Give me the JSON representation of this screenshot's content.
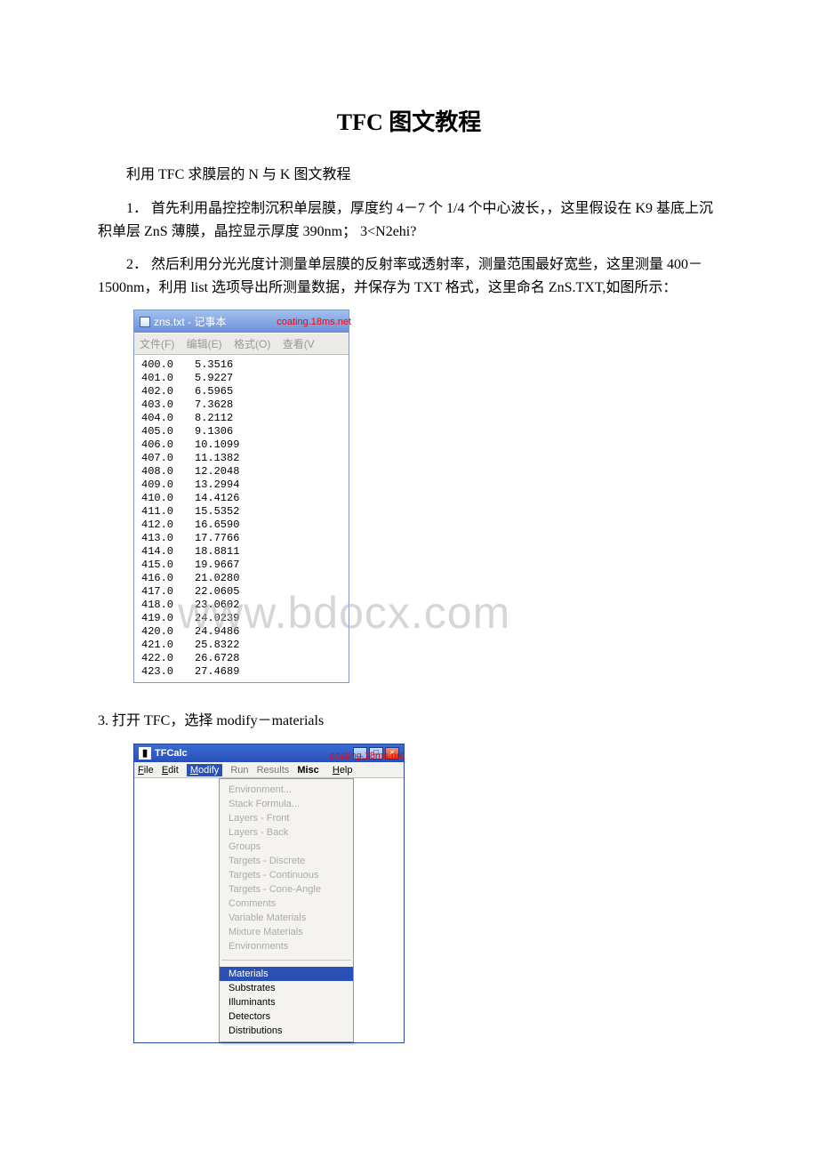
{
  "title": "TFC 图文教程",
  "paragraphs": {
    "p1": "利用 TFC 求膜层的 N 与 K 图文教程",
    "p2": "1．  首先利用晶控控制沉积单层膜，厚度约 4－7 个 1/4 个中心波长，，这里假设在 K9 基底上沉积单层 ZnS 薄膜，晶控显示厚度 390nm； 3<N2ehi?",
    "p3": "2．  然后利用分光光度计测量单层膜的反射率或透射率，测量范围最好宽些，这里测量 400－1500nm，利用 list 选项导出所测量数据，并保存为 TXT 格式，这里命名 ZnS.TXT,如图所示：",
    "p4": "3. 打开 TFC，选择 modify－materials"
  },
  "watermarks": {
    "site": "coating.18ms.net",
    "big": "www.bdocx.com"
  },
  "notepad": {
    "title": "zns.txt - 记事本",
    "menu": {
      "file": "文件(F)",
      "edit": "编辑(E)",
      "format": "格式(O)",
      "view": "查看(V"
    },
    "rows": [
      {
        "wl": "400.0",
        "val": "5.3516"
      },
      {
        "wl": "401.0",
        "val": "5.9227"
      },
      {
        "wl": "402.0",
        "val": "6.5965"
      },
      {
        "wl": "403.0",
        "val": "7.3628"
      },
      {
        "wl": "404.0",
        "val": "8.2112"
      },
      {
        "wl": "405.0",
        "val": "9.1306"
      },
      {
        "wl": "406.0",
        "val": "10.1099"
      },
      {
        "wl": "407.0",
        "val": "11.1382"
      },
      {
        "wl": "408.0",
        "val": "12.2048"
      },
      {
        "wl": "409.0",
        "val": "13.2994"
      },
      {
        "wl": "410.0",
        "val": "14.4126"
      },
      {
        "wl": "411.0",
        "val": "15.5352"
      },
      {
        "wl": "412.0",
        "val": "16.6590"
      },
      {
        "wl": "413.0",
        "val": "17.7766"
      },
      {
        "wl": "414.0",
        "val": "18.8811"
      },
      {
        "wl": "415.0",
        "val": "19.9667"
      },
      {
        "wl": "416.0",
        "val": "21.0280"
      },
      {
        "wl": "417.0",
        "val": "22.0605"
      },
      {
        "wl": "418.0",
        "val": "23.0602"
      },
      {
        "wl": "419.0",
        "val": "24.0239"
      },
      {
        "wl": "420.0",
        "val": "24.9486"
      },
      {
        "wl": "421.0",
        "val": "25.8322"
      },
      {
        "wl": "422.0",
        "val": "26.6728"
      },
      {
        "wl": "423.0",
        "val": "27.4689"
      }
    ]
  },
  "tfcalc": {
    "title": "TFCalc",
    "menubar": {
      "file": "File",
      "edit": "Edit",
      "modify": "Modify",
      "run": "Run",
      "results": "Results",
      "misc": "Misc",
      "help": "Help"
    },
    "dropdown": {
      "top": [
        "Environment...",
        "Stack Formula...",
        "Layers - Front",
        "Layers - Back",
        "Groups",
        "Targets - Discrete",
        "Targets - Continuous",
        "Targets - Cone-Angle",
        "Comments",
        "Variable Materials",
        "Mixture Materials",
        "Environments"
      ],
      "bottom": [
        "Materials",
        "Substrates",
        "Illuminants",
        "Detectors",
        "Distributions"
      ],
      "active": "Materials"
    }
  }
}
